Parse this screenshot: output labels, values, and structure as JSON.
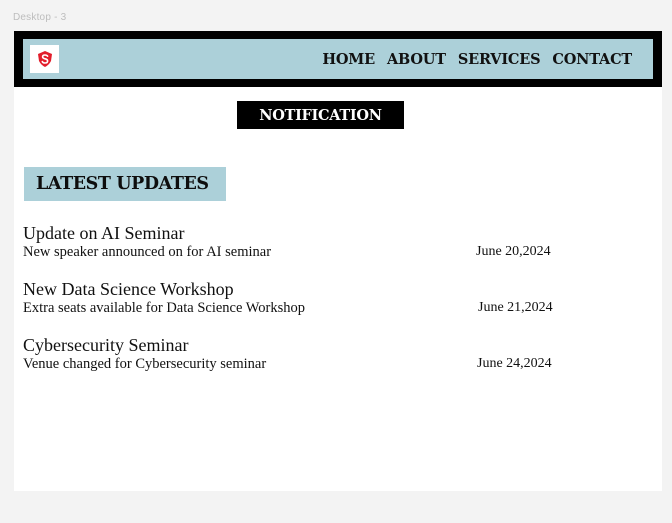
{
  "canvas": {
    "frame_label": "Desktop - 3"
  },
  "header": {
    "logo_icon": "red-s-shield-logo",
    "nav": [
      {
        "label": "HOME"
      },
      {
        "label": "ABOUT"
      },
      {
        "label": "SERVICES"
      },
      {
        "label": "CONTACT"
      }
    ],
    "colors": {
      "bar_background": "#000000",
      "bar_inner": "#acd0d9",
      "logo_accent": "#e21d2b"
    }
  },
  "notification": {
    "label": "NOTIFICATION"
  },
  "updates": {
    "heading": "LATEST UPDATES",
    "items": [
      {
        "title": "Update on AI  Seminar",
        "description": "New speaker announced on for AI seminar",
        "date": "June 20,2024"
      },
      {
        "title": "New Data Science Workshop",
        "description": "Extra seats available for Data Science Workshop",
        "date": "June 21,2024"
      },
      {
        "title": "Cybersecurity Seminar",
        "description": "Venue changed for Cybersecurity seminar",
        "date": "June 24,2024"
      }
    ]
  }
}
